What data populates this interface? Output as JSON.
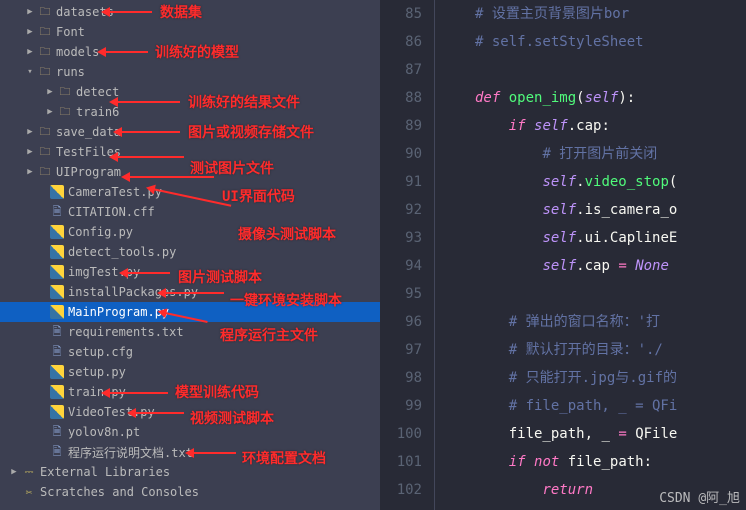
{
  "annotations": {
    "datasets": "数据集",
    "models": "训练好的模型",
    "runs_result": "训练好的结果文件",
    "save_data": "图片或视频存储文件",
    "test_files": "测试图片文件",
    "ui_program": "UI界面代码",
    "camera_test": "摄像头测试脚本",
    "img_test": "图片测试脚本",
    "install_packages": "一键环境安装脚本",
    "main_program": "程序运行主文件",
    "train": "模型训练代码",
    "video_test": "视频测试脚本",
    "readme": "环境配置文档"
  },
  "tree": {
    "datasets": "datasets",
    "font": "Font",
    "models": "models",
    "runs": "runs",
    "detect": "detect",
    "train6": "train6",
    "save_data": "save_data",
    "test_files": "TestFiles",
    "ui_program": "UIProgram",
    "camera_test": "CameraTest.py",
    "citation": "CITATION.cff",
    "config": "Config.py",
    "detect_tools": "detect_tools.py",
    "img_test": "imgTest.py",
    "install_packages": "installPackages.py",
    "main_program": "MainProgram.py",
    "requirements": "requirements.txt",
    "setup_cfg": "setup.cfg",
    "setup_py": "setup.py",
    "train": "train.py",
    "video_test": "VideoTest.py",
    "yolov8n": "yolov8n.pt",
    "readme": "程序运行说明文档.txt",
    "external_libs": "External Libraries",
    "scratches": "Scratches and Consoles"
  },
  "editor": {
    "lines": [
      {
        "n": 85,
        "html": "<span class='cmt'># 设置主页背景图片bor</span>"
      },
      {
        "n": 86,
        "html": "<span class='cmt'># self.setStyleSheet</span>"
      },
      {
        "n": 87,
        "html": ""
      },
      {
        "n": 88,
        "html": "<span class='kw'>def</span> <span class='fn'>open_img</span><span class='punc'>(</span><span class='self'>self</span><span class='punc'>):</span>"
      },
      {
        "n": 89,
        "html": "    <span class='kw'>if</span> <span class='self'>self</span><span class='punc'>.</span><span class='attr'>cap:</span>"
      },
      {
        "n": 90,
        "html": "        <span class='cmt'># 打开图片前关闭</span>"
      },
      {
        "n": 91,
        "html": "        <span class='self'>self</span><span class='punc'>.</span><span class='fn'>video_stop</span><span class='punc'>(</span>"
      },
      {
        "n": 92,
        "html": "        <span class='self'>self</span><span class='punc'>.</span><span class='attr'>is_camera_o</span>"
      },
      {
        "n": 93,
        "html": "        <span class='self'>self</span><span class='punc'>.</span><span class='attr'>ui</span><span class='punc'>.</span><span class='attr'>CaplineE</span>"
      },
      {
        "n": 94,
        "html": "        <span class='self'>self</span><span class='punc'>.</span><span class='attr'>cap</span> <span class='op'>=</span> <span class='none'>None</span>"
      },
      {
        "n": 95,
        "html": ""
      },
      {
        "n": 96,
        "html": "    <span class='cmt'># 弹出的窗口名称：'打</span>"
      },
      {
        "n": 97,
        "html": "    <span class='cmt'># 默认打开的目录：'./</span>"
      },
      {
        "n": 98,
        "html": "    <span class='cmt'># 只能打开.jpg与.gif&#x7684;</span>"
      },
      {
        "n": 99,
        "html": "    <span class='cmt'># file_path, _ = QFi</span>"
      },
      {
        "n": 100,
        "html": "    <span class='attr'>file_path</span><span class='punc'>,</span> <span class='attr'>_</span> <span class='op'>=</span> <span class='attr'>QFile</span>"
      },
      {
        "n": 101,
        "html": "    <span class='kw'>if</span> <span class='kw'>not</span> <span class='attr'>file_path</span><span class='punc'>:</span>"
      },
      {
        "n": 102,
        "html": "        <span class='kw'>return</span>"
      }
    ]
  },
  "watermark": "CSDN @阿_旭"
}
